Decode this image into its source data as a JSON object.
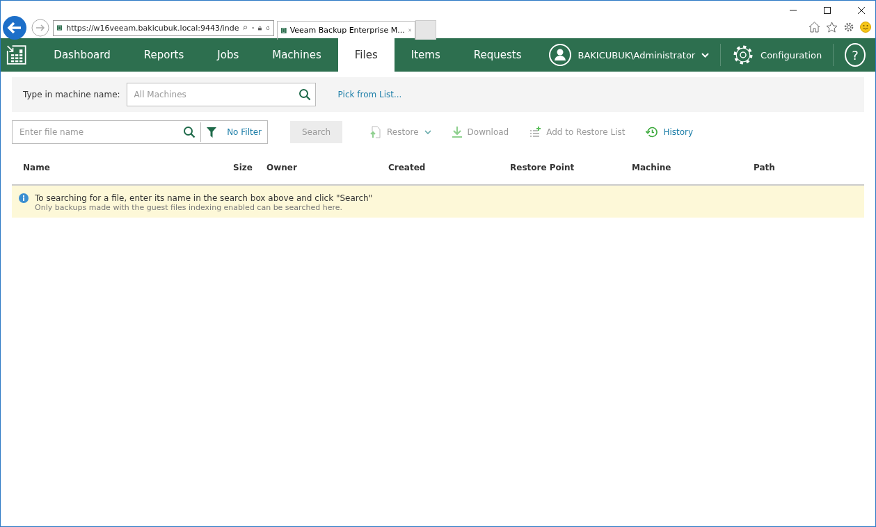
{
  "browser": {
    "url": "https://w16veeam.bakicubuk.local:9443/inde",
    "tab_title": "Veeam Backup Enterprise M..."
  },
  "nav": {
    "tabs": [
      {
        "label": "Dashboard",
        "selected": false
      },
      {
        "label": "Reports",
        "selected": false
      },
      {
        "label": "Jobs",
        "selected": false
      },
      {
        "label": "Machines",
        "selected": false
      },
      {
        "label": "Files",
        "selected": true
      },
      {
        "label": "Items",
        "selected": false
      },
      {
        "label": "Requests",
        "selected": false
      }
    ],
    "user": "BAKICUBUK\\Administrator",
    "configuration": "Configuration",
    "help": "?"
  },
  "machine_filter": {
    "label": "Type in machine name:",
    "placeholder": "All Machines",
    "link": "Pick from List..."
  },
  "file_search": {
    "placeholder": "Enter file name",
    "filter": "No Filter",
    "search_button": {
      "label": "Search",
      "disabled": true
    }
  },
  "actions": [
    {
      "kind": "restore",
      "label": "Restore",
      "disabled": true
    },
    {
      "kind": "download",
      "label": "Download",
      "disabled": true
    },
    {
      "kind": "add",
      "label": "Add to Restore List",
      "disabled": true
    },
    {
      "kind": "history",
      "label": "History",
      "disabled": false
    }
  ],
  "table": {
    "columns": [
      "Name",
      "Size",
      "Owner",
      "Created",
      "Restore Point",
      "Machine",
      "Path"
    ]
  },
  "info": {
    "title": "To searching for a file, enter its name in the search box above and click \"Search\"",
    "detail": "Only backups made with the guest files indexing enabled can be searched here."
  }
}
